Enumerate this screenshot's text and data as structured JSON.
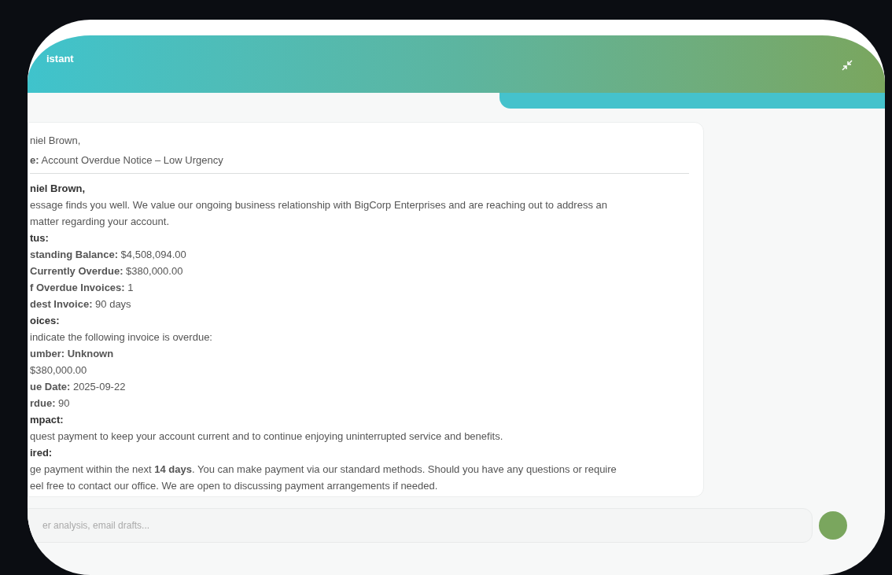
{
  "header": {
    "title": "istant"
  },
  "message": {
    "header_lines": [
      "niel Brown,",
      "**e:** Account Overdue Notice – Low Urgency"
    ],
    "lines": [
      {
        "kind": "heading",
        "text": "niel Brown,"
      },
      {
        "kind": "text",
        "text": "essage finds you well. We value our ongoing business relationship with BigCorp Enterprises and are reaching out to address an"
      },
      {
        "kind": "text",
        "text": "matter regarding your account."
      },
      {
        "kind": "heading",
        "text": "tus:"
      },
      {
        "kind": "text",
        "text": "**standing Balance:** $4,508,094.00"
      },
      {
        "kind": "text",
        "text": "**Currently Overdue:** $380,000.00"
      },
      {
        "kind": "text",
        "text": "**f Overdue Invoices:** 1"
      },
      {
        "kind": "text",
        "text": "**dest Invoice:** 90 days"
      },
      {
        "kind": "heading",
        "text": "oices:"
      },
      {
        "kind": "text",
        "text": "indicate the following invoice is overdue:"
      },
      {
        "kind": "text",
        "text": "**umber: Unknown**"
      },
      {
        "kind": "text",
        "text": "$380,000.00"
      },
      {
        "kind": "text",
        "text": "**ue Date:** 2025-09-22"
      },
      {
        "kind": "text",
        "text": "**rdue:** 90"
      },
      {
        "kind": "heading",
        "text": "mpact:"
      },
      {
        "kind": "text",
        "text": "quest payment to keep your account current and to continue enjoying uninterrupted service and benefits."
      },
      {
        "kind": "heading",
        "text": "ired:"
      },
      {
        "kind": "text",
        "text": "ge payment within the next **14 days**. You can make payment via our standard methods. Should you have any questions or require"
      },
      {
        "kind": "text",
        "text": "eel free to contact our office. We are open to discussing payment arrangements if needed."
      }
    ]
  },
  "input": {
    "placeholder": "er analysis, email drafts..."
  }
}
